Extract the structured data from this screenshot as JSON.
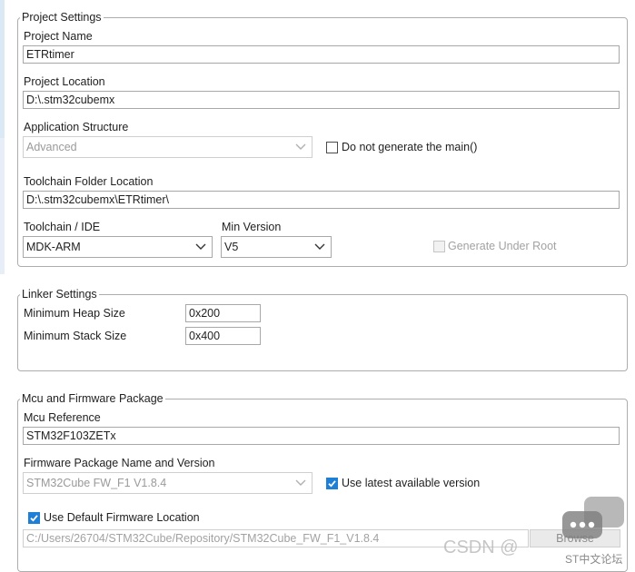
{
  "project": {
    "legend": "Project Settings",
    "name_label": "Project Name",
    "name_value": "ETRtimer",
    "location_label": "Project Location",
    "location_value": "D:\\.stm32cubemx",
    "app_structure_label": "Application Structure",
    "app_structure_value": "Advanced",
    "no_main_label": "Do not generate the main()",
    "no_main_checked": false,
    "toolchain_folder_label": "Toolchain Folder Location",
    "toolchain_folder_value": "D:\\.stm32cubemx\\ETRtimer\\",
    "toolchain_label": "Toolchain / IDE",
    "toolchain_value": "MDK-ARM",
    "min_version_label": "Min Version",
    "min_version_value": "V5",
    "gen_under_root_label": "Generate Under Root",
    "gen_under_root_checked": false
  },
  "linker": {
    "legend": "Linker Settings",
    "heap_label": "Minimum Heap Size",
    "heap_value": "0x200",
    "stack_label": "Minimum Stack Size",
    "stack_value": "0x400"
  },
  "mcu": {
    "legend": "Mcu and Firmware Package",
    "reference_label": "Mcu Reference",
    "reference_value": "STM32F103ZETx",
    "firmware_label": "Firmware Package Name and Version",
    "firmware_value": "STM32Cube FW_F1 V1.8.4",
    "use_latest_label": "Use latest available version",
    "use_latest_checked": true,
    "default_location_label": "Use Default Firmware Location",
    "default_location_checked": true,
    "firmware_path": "C:/Users/26704/STM32Cube/Repository/STM32Cube_FW_F1_V1.8.4",
    "browse_label": "Browse"
  },
  "watermark": {
    "csdn": "CSDN @",
    "forum": "ST中文论坛"
  },
  "colors": {
    "check_blue": "#1e7fd6",
    "group_border": "#adadad"
  }
}
